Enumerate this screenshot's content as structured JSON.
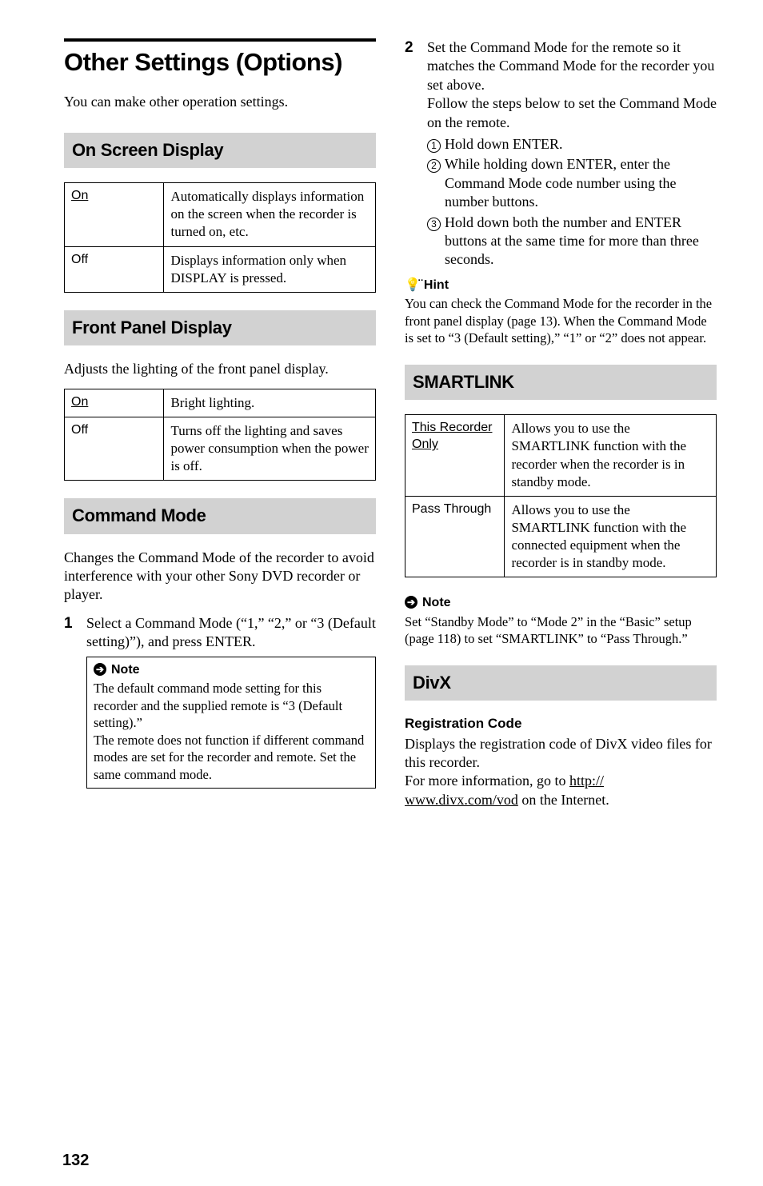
{
  "page_number": "132",
  "left": {
    "title": "Other Settings (Options)",
    "intro": "You can make other operation settings.",
    "sections": {
      "osd": {
        "heading": "On Screen Display",
        "rows": [
          {
            "key": "On",
            "underline": true,
            "desc": "Automatically displays information on the screen when the recorder is turned on, etc."
          },
          {
            "key": "Off",
            "underline": false,
            "desc": "Displays information only when DISPLAY is pressed."
          }
        ]
      },
      "fpd": {
        "heading": "Front Panel Display",
        "intro": "Adjusts the lighting of the front panel display.",
        "rows": [
          {
            "key": "On",
            "underline": true,
            "desc": "Bright lighting."
          },
          {
            "key": "Off",
            "underline": false,
            "desc": "Turns off the lighting and saves power consumption when the power is off."
          }
        ]
      },
      "cmd": {
        "heading": "Command Mode",
        "intro": "Changes the Command Mode of the recorder to avoid interference with your other Sony DVD recorder or player.",
        "step1_num": "1",
        "step1_text": "Select a Command Mode (“1,” “2,” or “3 (Default setting)”), and press ENTER.",
        "note_label": "Note",
        "note_body_1": "The default command mode setting for this recorder and the supplied remote is “3 (Default setting).”",
        "note_body_2": "The remote does not function if different command modes are set for the recorder and remote. Set the same command mode."
      }
    }
  },
  "right": {
    "step2_num": "2",
    "step2_text_a": "Set the Command Mode for the remote so it matches the Command Mode for the recorder you set above.",
    "step2_text_b": "Follow the steps below to set the Command Mode on the remote.",
    "sub": [
      {
        "n": "1",
        "t": "Hold down ENTER."
      },
      {
        "n": "2",
        "t": "While holding down ENTER, enter the Command Mode code number using the number buttons."
      },
      {
        "n": "3",
        "t": "Hold down both the number and ENTER buttons at the same time for more than three seconds."
      }
    ],
    "hint_label": "Hint",
    "hint_body": "You can check the Command Mode for the recorder in the front panel display (page 13). When the Command Mode is set to “3 (Default setting),” “1” or “2” does not appear.",
    "smartlink": {
      "heading": "SMARTLINK",
      "rows": [
        {
          "key": "This Recorder Only",
          "underline": true,
          "desc": "Allows you to use the SMARTLINK function with the recorder when the recorder is in standby mode."
        },
        {
          "key": "Pass Through",
          "underline": false,
          "desc": "Allows you to use the SMARTLINK function with the connected equipment when the recorder is in standby mode."
        }
      ],
      "note_label": "Note",
      "note_body": "Set “Standby Mode” to “Mode 2” in the “Basic” setup (page 118) to set “SMARTLINK” to “Pass Through.”"
    },
    "divx": {
      "heading": "DivX",
      "sub_heading": "Registration Code",
      "body_a": "Displays the registration code of DivX video files for this recorder.",
      "body_b_pre": "For more information, go to ",
      "body_b_link1": "http://",
      "body_b_link2": "www.divx.com/vod",
      "body_b_post": " on the Internet."
    }
  }
}
